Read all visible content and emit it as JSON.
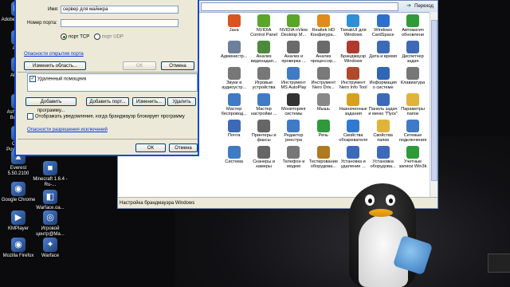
{
  "desktop": {
    "icons": [
      {
        "label": "Adobe Photos...",
        "icon": "photoshop-icon"
      },
      {
        "label": "AIMP",
        "icon": "aimp-icon"
      },
      {
        "label": "Alcohol",
        "icon": "alcohol-icon"
      },
      {
        "label": "Ashampoo Burning",
        "icon": "ashampoo-icon"
      },
      {
        "label": "Cyber PowerDVD",
        "icon": "powerdvd-icon"
      },
      {
        "label": "Everest 5.50.2100",
        "icon": "everest-icon"
      },
      {
        "label": "Google Chrome",
        "icon": "chrome-icon"
      },
      {
        "label": "KMPlayer",
        "icon": "kmplayer-icon"
      },
      {
        "label": "Mozilla Firefox",
        "icon": "firefox-icon"
      },
      {
        "label": "Minecraft 1.6.4 - Ru-...",
        "icon": "minecraft-icon"
      },
      {
        "label": "Warface.oa...",
        "icon": "warface-file-icon"
      },
      {
        "label": "Игровой центр@Ma...",
        "icon": "game-center-icon"
      },
      {
        "label": "Warface",
        "icon": "warface-icon"
      }
    ]
  },
  "control_panel": {
    "go_label": "Переход",
    "status_text": "Настройка брандмауэра Windows",
    "items": [
      {
        "label": "Java",
        "color": "#d9541e",
        "icon": "java-icon"
      },
      {
        "label": "NVIDIA Control Panel",
        "color": "#5aa52a",
        "icon": "nvidia-icon"
      },
      {
        "label": "NVIDIA nView Desktop M...",
        "color": "#5aa52a",
        "icon": "nview-icon"
      },
      {
        "label": "Realtek HD Конфигура...",
        "color": "#e08b1a",
        "icon": "realtek-icon"
      },
      {
        "label": "TweakUI для Windows",
        "color": "#2d8fd6",
        "icon": "tweakui-icon"
      },
      {
        "label": "Windows CardSpace",
        "color": "#2e6fc9",
        "icon": "cardspace-icon"
      },
      {
        "label": "Автоматич обновлени",
        "color": "#2f9a3a",
        "icon": "auto-update-icon"
      },
      {
        "label": "Администр...",
        "color": "#6d7f9a",
        "icon": "admin-tools-icon"
      },
      {
        "label": "Анализ видеоадап...",
        "color": "#4c8a3c",
        "icon": "video-analysis-icon"
      },
      {
        "label": "Анализ и проверка ...",
        "color": "#6a6a6a",
        "icon": "check-icon"
      },
      {
        "label": "Анализ процессор...",
        "color": "#6a6a6a",
        "icon": "cpu-analysis-icon"
      },
      {
        "label": "Брандмауэр Windows",
        "color": "#b03a2e",
        "icon": "firewall-icon"
      },
      {
        "label": "Дата и время",
        "color": "#3c6ab8",
        "icon": "clock-icon"
      },
      {
        "label": "Диспетчер задач",
        "color": "#3c6ab8",
        "icon": "task-manager-icon"
      },
      {
        "label": "Звуки и аудиоустр...",
        "color": "#777777",
        "icon": "speaker-icon"
      },
      {
        "label": "Игровые устройства",
        "color": "#777777",
        "icon": "gamepad-icon"
      },
      {
        "label": "Инструмент MS AutoPlay",
        "color": "#3f7bc4",
        "icon": "autoplay-icon"
      },
      {
        "label": "Инструмент Nero Driv...",
        "color": "#7a7a7a",
        "icon": "nero-drive-icon"
      },
      {
        "label": "Инструмент Nero Info Tool",
        "color": "#b04a2a",
        "icon": "nero-info-icon"
      },
      {
        "label": "Информация о системе",
        "color": "#2f67b5",
        "icon": "system-info-icon"
      },
      {
        "label": "Клавиатура",
        "color": "#777777",
        "icon": "keyboard-icon"
      },
      {
        "label": "Мастер беспровод...",
        "color": "#3f7bc4",
        "icon": "wireless-icon"
      },
      {
        "label": "Мастер настройки ...",
        "color": "#3f7bc4",
        "icon": "setup-wizard-icon"
      },
      {
        "label": "Мониторинг системы",
        "color": "#333333",
        "icon": "monitoring-icon"
      },
      {
        "label": "Мышь",
        "color": "#888888",
        "icon": "mouse-icon"
      },
      {
        "label": "Назначенные задания",
        "color": "#d6a21e",
        "icon": "scheduled-tasks-icon"
      },
      {
        "label": "Панель задач и меню \"Пуск\"",
        "color": "#3c6ab8",
        "icon": "taskbar-icon"
      },
      {
        "label": "Параметры папок",
        "color": "#e0b33a",
        "icon": "folder-options-icon"
      },
      {
        "label": "Почта",
        "color": "#3c6ab8",
        "icon": "mail-icon"
      },
      {
        "label": "Принтеры и факсы",
        "color": "#666666",
        "icon": "printer-icon"
      },
      {
        "label": "Редактор реестра",
        "color": "#3f7bc4",
        "icon": "registry-icon"
      },
      {
        "label": "Речь",
        "color": "#2f9a3a",
        "icon": "speech-icon"
      },
      {
        "label": "Свойства обозревателя",
        "color": "#2f7ad0",
        "icon": "ie-icon"
      },
      {
        "label": "Свойства папки",
        "color": "#e0b33a",
        "icon": "folder-icon"
      },
      {
        "label": "Сетевые подключения",
        "color": "#3f7bc4",
        "icon": "network-icon"
      },
      {
        "label": "Система",
        "color": "#3f7bc4",
        "icon": "system-icon"
      },
      {
        "label": "Сканеры и камеры",
        "color": "#666666",
        "icon": "scanner-icon"
      },
      {
        "label": "Телефон и модем",
        "color": "#777777",
        "icon": "phone-icon"
      },
      {
        "label": "Тестирование оборудова...",
        "color": "#b07a1e",
        "icon": "hardware-test-icon"
      },
      {
        "label": "Установка и удаление ...",
        "color": "#3c6ab8",
        "icon": "add-remove-icon"
      },
      {
        "label": "Установка оборудова...",
        "color": "#3c6ab8",
        "icon": "hardware-setup-icon"
      },
      {
        "label": "Учетные записи Win3k",
        "color": "#2f9a3a",
        "icon": "user-accounts-icon"
      }
    ]
  },
  "firewall_dialog": {
    "name_label": "Имя:",
    "name_value": "сервер для майнкра",
    "port_label": "Номер порта:",
    "port_value": "",
    "tcp_label": "порт TCP",
    "udp_label": "порт UDP",
    "risks_link": "Опасности открытия порта",
    "change_scope_button": "Изменить область...",
    "ok_inner": "ОК",
    "cancel_inner": "Отмена",
    "remote_assistant": "Удаленный помощник",
    "add_program_button": "Добавить программу...",
    "add_port_button": "Добавить порт...",
    "edit_button": "Изменить...",
    "delete_button": "Удалить",
    "notify_label": "Отображать уведомление, когда брандмауэр блокирует программу",
    "exceptions_risks_link": "Опасности разрешения исключений",
    "ok_button": "ОК",
    "cancel_button": "Отмена"
  }
}
